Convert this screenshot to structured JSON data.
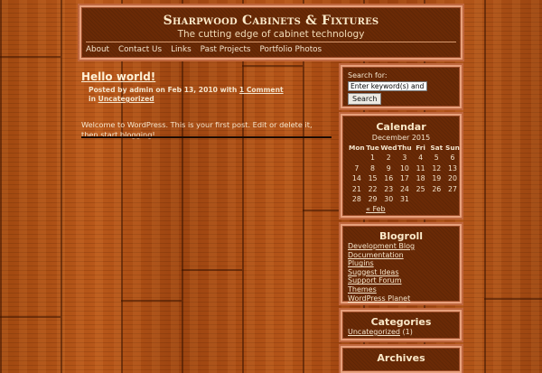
{
  "header": {
    "site_title": "Sharpwood Cabinets & Fixtures",
    "tagline": "The cutting edge of cabinet technology",
    "nav": [
      "About",
      "Contact Us",
      "Links",
      "Past Projects",
      "Portfolio Photos"
    ]
  },
  "post": {
    "title": "Hello world!",
    "posted_by": "Posted by admin on Feb 13, 2010 with",
    "comments_link": "1 Comment",
    "in_label": "in",
    "category_link": "Uncategorized",
    "body": "Welcome to WordPress. This is your first post. Edit or delete it, then start blogging!"
  },
  "search": {
    "label": "Search for:",
    "input_value": "Enter keyword(s) and",
    "button": "Search"
  },
  "calendar": {
    "title": "Calendar",
    "caption": "December 2015",
    "days": [
      "Mon",
      "Tue",
      "Wed",
      "Thu",
      "Fri",
      "Sat",
      "Sun"
    ],
    "weeks": [
      [
        "",
        "1",
        "2",
        "3",
        "4",
        "5",
        "6"
      ],
      [
        "7",
        "8",
        "9",
        "10",
        "11",
        "12",
        "13"
      ],
      [
        "14",
        "15",
        "16",
        "17",
        "18",
        "19",
        "20"
      ],
      [
        "21",
        "22",
        "23",
        "24",
        "25",
        "26",
        "27"
      ],
      [
        "28",
        "29",
        "30",
        "31",
        "",
        "",
        ""
      ]
    ],
    "prev_link": "« Feb"
  },
  "blogroll": {
    "title": "Blogroll",
    "links": [
      "Development Blog",
      "Documentation",
      "Plugins",
      "Suggest Ideas",
      "Support Forum",
      "Themes",
      "WordPress Planet"
    ]
  },
  "categories": {
    "title": "Categories",
    "item": "Uncategorized",
    "count": "(1)"
  },
  "archives": {
    "title": "Archives"
  }
}
